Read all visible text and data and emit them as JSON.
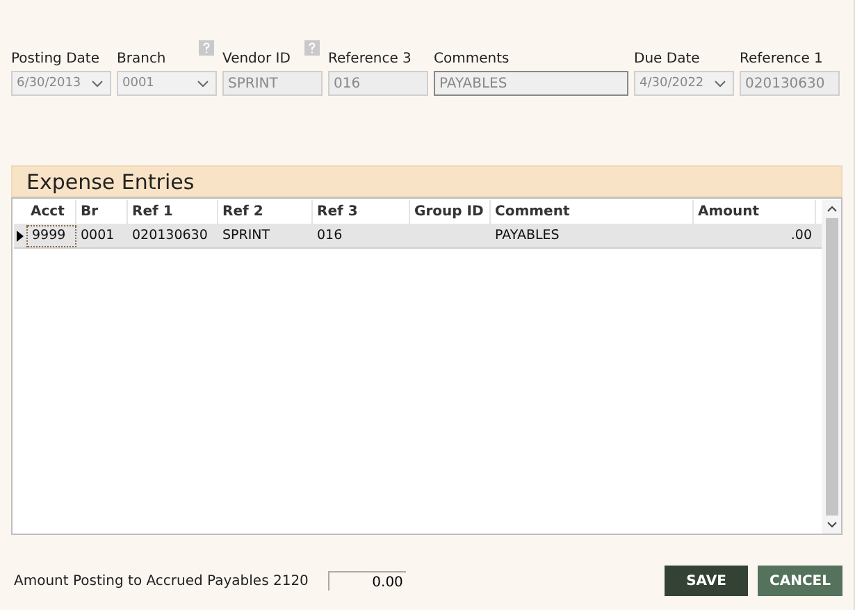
{
  "header_fields": [
    {
      "label": "Posting  Date",
      "kind": "dropdown",
      "value": "6/30/2013",
      "help": false,
      "disabled": true
    },
    {
      "label": "Branch",
      "kind": "dropdown",
      "value": "0001",
      "help": true,
      "disabled": true
    },
    {
      "label": "Vendor ID",
      "kind": "text",
      "value": "SPRINT",
      "help": true,
      "disabled": true
    },
    {
      "label": "Reference 3",
      "kind": "text",
      "value": "016",
      "help": false,
      "disabled": true
    },
    {
      "label": "Comments",
      "kind": "wide_text",
      "value": "PAYABLES",
      "help": false,
      "disabled": true
    },
    {
      "label": "Due Date",
      "kind": "dropdown",
      "value": "4/30/2022",
      "help": false,
      "disabled": true
    },
    {
      "label": "Reference 1",
      "kind": "text",
      "value": "020130630",
      "help": false,
      "disabled": true
    }
  ],
  "grid": {
    "title": "Expense Entries",
    "columns": [
      "Acct",
      "Br",
      "Ref 1",
      "Ref 2",
      "Ref 3",
      "Group ID",
      "Comment",
      "Amount"
    ],
    "rows": [
      {
        "selected": true,
        "cells": [
          "9999",
          "0001",
          "020130630",
          "SPRINT",
          "016",
          "",
          "PAYABLES",
          ".00"
        ]
      }
    ]
  },
  "footer": {
    "label": "Amount Posting to Accrued Payables 2120",
    "value": "0.00",
    "buttons": [
      "SAVE",
      "CANCEL"
    ]
  }
}
